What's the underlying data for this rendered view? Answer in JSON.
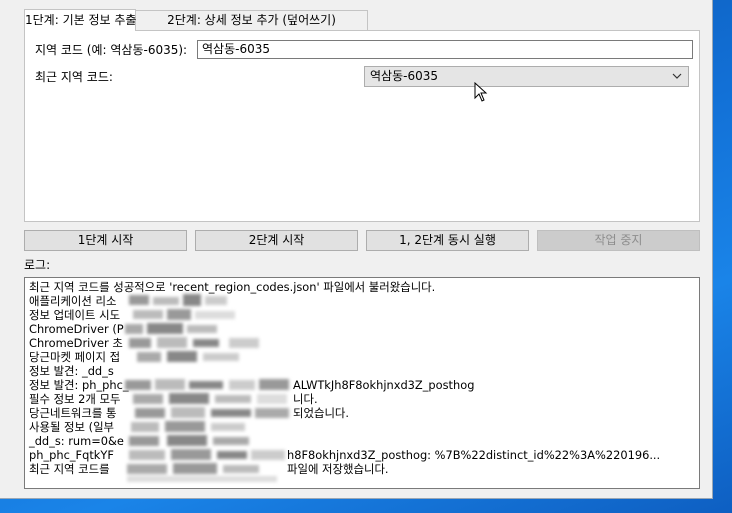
{
  "tabs": [
    {
      "label": "1단계: 기본 정보 추출"
    },
    {
      "label": "2단계: 상세 정보 추가 (덮어쓰기)"
    }
  ],
  "form": {
    "region_code_label": "지역 코드 (예: 역삼동-6035):",
    "region_code_value": "역삼동-6035",
    "recent_codes_label": "최근 지역 코드:",
    "recent_codes_selected": "역삼동-6035"
  },
  "buttons": {
    "step1": "1단계 시작",
    "step2": "2단계 시작",
    "both": "1, 2단계 동시 실행",
    "stop": "작업 중지"
  },
  "log": {
    "label": "로그:",
    "lines": [
      "최근 지역 코드를 성공적으로 'recent_region_codes.json' 파일에서 불러왔습니다.",
      "애플리케이션 리소",
      "정보 업데이트 시도",
      "ChromeDriver (P",
      "ChromeDriver 초",
      "당근마켓 페이지 접",
      "정보 발견: _dd_s",
      "정보 발견: ph_phc_",
      "필수 정보 2개 모두",
      "당근네트워크를 통",
      "사용될 정보 (일부",
      "  _dd_s: rum=0&e",
      "  ph_phc_FqtkYF",
      "최근 지역 코드를"
    ],
    "tails": {
      "l7": "ALWTkJh8F8okhjnxd3Z_posthog",
      "l8": "니다.",
      "l9": "되었습니다.",
      "l12": "h8F8okhjnxd3Z_posthog: %7B%22distinct_id%22%3A%220196...",
      "l13": "파일에 저장했습니다."
    }
  },
  "colors": {
    "window_bg": "#f0f0f0",
    "button_bg": "#e1e1e1",
    "disabled_text": "#8d8d8d",
    "desktop": "#1270d6"
  }
}
